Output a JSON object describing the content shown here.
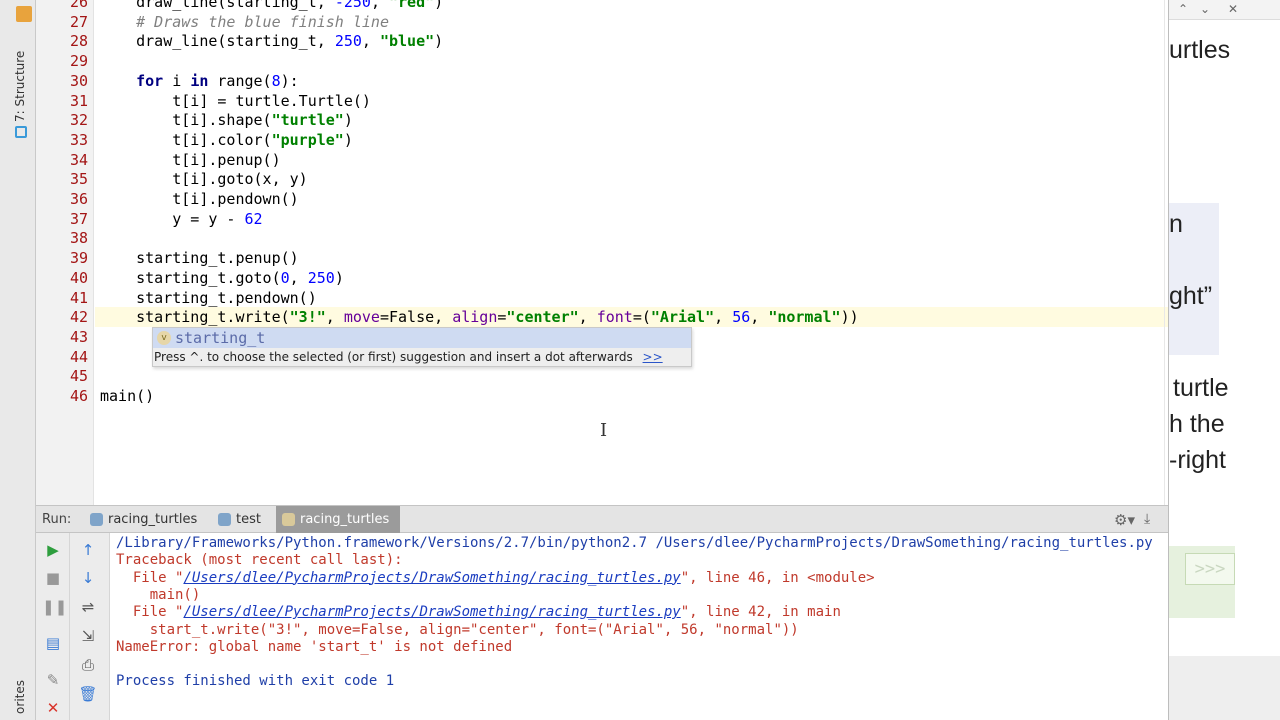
{
  "side_tabs": {
    "structure": "7: Structure",
    "favorites": "orites"
  },
  "editor": {
    "lines": [
      {
        "n": "26",
        "parts": [
          {
            "t": "    draw_line(starting_t, ",
            "c": ""
          },
          {
            "t": "-250",
            "c": "num"
          },
          {
            "t": ", ",
            "c": ""
          },
          {
            "t": "\"red\"",
            "c": "str"
          },
          {
            "t": ")",
            "c": ""
          }
        ]
      },
      {
        "n": "27",
        "parts": [
          {
            "t": "    # Draws the blue finish line",
            "c": "cmt"
          }
        ]
      },
      {
        "n": "28",
        "parts": [
          {
            "t": "    draw_line(starting_t, ",
            "c": ""
          },
          {
            "t": "250",
            "c": "num"
          },
          {
            "t": ", ",
            "c": ""
          },
          {
            "t": "\"blue\"",
            "c": "str"
          },
          {
            "t": ")",
            "c": ""
          }
        ]
      },
      {
        "n": "29",
        "parts": []
      },
      {
        "n": "30",
        "parts": [
          {
            "t": "    ",
            "c": ""
          },
          {
            "t": "for",
            "c": "kw"
          },
          {
            "t": " i ",
            "c": ""
          },
          {
            "t": "in",
            "c": "kw"
          },
          {
            "t": " range(",
            "c": ""
          },
          {
            "t": "8",
            "c": "num"
          },
          {
            "t": "):",
            "c": ""
          }
        ]
      },
      {
        "n": "31",
        "parts": [
          {
            "t": "        t[i] = turtle.Turtle()",
            "c": ""
          }
        ]
      },
      {
        "n": "32",
        "parts": [
          {
            "t": "        t[i].shape(",
            "c": ""
          },
          {
            "t": "\"turtle\"",
            "c": "str"
          },
          {
            "t": ")",
            "c": ""
          }
        ]
      },
      {
        "n": "33",
        "parts": [
          {
            "t": "        t[i].color(",
            "c": ""
          },
          {
            "t": "\"purple\"",
            "c": "str"
          },
          {
            "t": ")",
            "c": ""
          }
        ]
      },
      {
        "n": "34",
        "parts": [
          {
            "t": "        t[i].penup()",
            "c": ""
          }
        ]
      },
      {
        "n": "35",
        "parts": [
          {
            "t": "        t[i].goto(x, y)",
            "c": ""
          }
        ]
      },
      {
        "n": "36",
        "parts": [
          {
            "t": "        t[i].pendown()",
            "c": ""
          }
        ]
      },
      {
        "n": "37",
        "parts": [
          {
            "t": "        y = y - ",
            "c": ""
          },
          {
            "t": "62",
            "c": "num"
          }
        ]
      },
      {
        "n": "38",
        "parts": []
      },
      {
        "n": "39",
        "parts": [
          {
            "t": "    starting_t.penup()",
            "c": ""
          }
        ]
      },
      {
        "n": "40",
        "parts": [
          {
            "t": "    starting_t.goto(",
            "c": ""
          },
          {
            "t": "0",
            "c": "num"
          },
          {
            "t": ", ",
            "c": ""
          },
          {
            "t": "250",
            "c": "num"
          },
          {
            "t": ")",
            "c": ""
          }
        ]
      },
      {
        "n": "41",
        "parts": [
          {
            "t": "    starting_t.pendown()",
            "c": ""
          }
        ]
      },
      {
        "n": "42",
        "parts": [
          {
            "t": "    starting_t.write(",
            "c": ""
          },
          {
            "t": "\"3!\"",
            "c": "str"
          },
          {
            "t": ", ",
            "c": ""
          },
          {
            "t": "move",
            "c": "kwarg"
          },
          {
            "t": "=False, ",
            "c": ""
          },
          {
            "t": "align",
            "c": "kwarg"
          },
          {
            "t": "=",
            "c": ""
          },
          {
            "t": "\"center\"",
            "c": "str"
          },
          {
            "t": ", ",
            "c": ""
          },
          {
            "t": "font",
            "c": "kwarg"
          },
          {
            "t": "=(",
            "c": ""
          },
          {
            "t": "\"Arial\"",
            "c": "str"
          },
          {
            "t": ", ",
            "c": ""
          },
          {
            "t": "56",
            "c": "num"
          },
          {
            "t": ", ",
            "c": ""
          },
          {
            "t": "\"normal\"",
            "c": "str"
          },
          {
            "t": "))",
            "c": ""
          }
        ]
      },
      {
        "n": "43",
        "parts": []
      },
      {
        "n": "44",
        "parts": []
      },
      {
        "n": "45",
        "parts": []
      },
      {
        "n": "46",
        "parts": [
          {
            "t": "main()",
            "c": ""
          }
        ]
      }
    ],
    "completion": {
      "item": "starting_t",
      "item_icon": "v",
      "hint": "Press ^. to choose the selected (or first) suggestion and insert a dot afterwards",
      "hint_link": ">>"
    }
  },
  "right_panel": {
    "texts": [
      "urtles",
      "n",
      "ght”",
      "turtle",
      "h  the",
      "-right"
    ],
    "prompt": ">>>"
  },
  "run": {
    "label": "Run:",
    "tabs": [
      {
        "label": "racing_turtles"
      },
      {
        "label": "test"
      },
      {
        "label": "racing_turtles"
      }
    ],
    "console": [
      {
        "t": "/Library/Frameworks/Python.framework/Versions/2.7/bin/python2.7 /Users/dlee/PycharmProjects/DrawSomething/racing_turtles.py",
        "kind": "plain"
      },
      {
        "t": "Traceback (most recent call last):",
        "kind": "err"
      },
      {
        "pre": "  File \"",
        "link": "/Users/dlee/PycharmProjects/DrawSomething/racing_turtles.py",
        "post": "\", line 46, in <module>",
        "kind": "err"
      },
      {
        "t": "    main()",
        "kind": "err"
      },
      {
        "pre": "  File \"",
        "link": "/Users/dlee/PycharmProjects/DrawSomething/racing_turtles.py",
        "post": "\", line 42, in main",
        "kind": "err"
      },
      {
        "t": "    start_t.write(\"3!\", move=False, align=\"center\", font=(\"Arial\", 56, \"normal\"))",
        "kind": "err"
      },
      {
        "t": "NameError: global name 'start_t' is not defined",
        "kind": "err"
      },
      {
        "t": "",
        "kind": "plain"
      },
      {
        "t": "Process finished with exit code 1",
        "kind": "plain"
      }
    ]
  },
  "colors": {
    "run_icon": "#2e9e3e",
    "arrow_icon": "#3a7bd5",
    "close_icon": "#d9342b"
  }
}
